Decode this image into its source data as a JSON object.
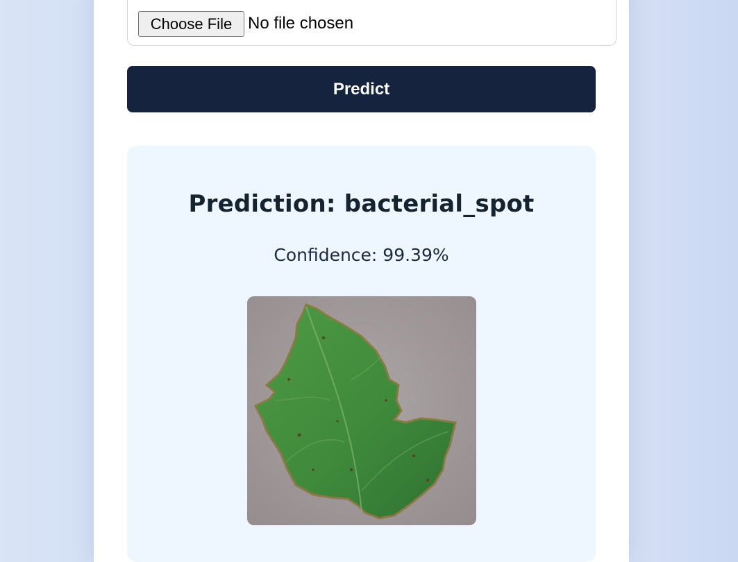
{
  "upload": {
    "choose_file_label": "Choose File",
    "file_status": "No file chosen"
  },
  "actions": {
    "predict_label": "Predict"
  },
  "result": {
    "prediction": "Prediction: bacterial_spot",
    "confidence": "Confidence: 99.39%",
    "image_subject": "tomato-leaf"
  },
  "colors": {
    "primary_button": "#15233f",
    "result_background": "#eef7ff",
    "page_background": "#dde6f5"
  }
}
